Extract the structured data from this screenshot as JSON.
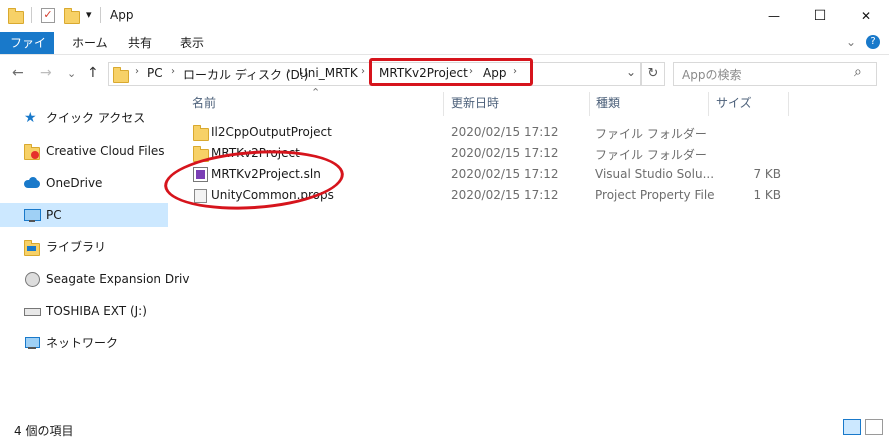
{
  "window": {
    "title": "App",
    "minimize_glyph": "—",
    "maximize_glyph": "☐",
    "close_glyph": "✕"
  },
  "ribbon": {
    "tabs": [
      {
        "label": "ファイル"
      },
      {
        "label": "ホーム"
      },
      {
        "label": "共有"
      },
      {
        "label": "表示"
      }
    ],
    "expand_glyph": "⌄",
    "help_glyph": "?"
  },
  "nav": {
    "back_glyph": "←",
    "forward_glyph": "→",
    "recent_glyph": "⌄",
    "up_glyph": "↑",
    "breadcrumbs": [
      "PC",
      "ローカル ディスク (D:)",
      "Uni_MRTK",
      "MRTKv2Project",
      "App"
    ],
    "sep_glyph": "›",
    "dropdown_glyph": "⌄",
    "refresh_glyph": "↻",
    "search_placeholder": "Appの検索",
    "search_glyph": "⌕"
  },
  "sidebar": {
    "items": [
      {
        "label": "クイック アクセス",
        "icon": "star-icon"
      },
      {
        "label": "Creative Cloud Files",
        "icon": "creative-cloud-icon"
      },
      {
        "label": "OneDrive",
        "icon": "cloud-icon"
      },
      {
        "label": "PC",
        "icon": "pc-icon",
        "selected": true
      },
      {
        "label": "ライブラリ",
        "icon": "library-icon"
      },
      {
        "label": "Seagate Expansion Driv",
        "icon": "drive-icon"
      },
      {
        "label": "TOSHIBA EXT (J:)",
        "icon": "drive-icon"
      },
      {
        "label": "ネットワーク",
        "icon": "network-icon"
      }
    ]
  },
  "columns": {
    "name": "名前",
    "modified": "更新日時",
    "type": "種類",
    "size": "サイズ",
    "sort_glyph": "⌃"
  },
  "files": [
    {
      "name": "Il2CppOutputProject",
      "modified": "2020/02/15 17:12",
      "type": "ファイル フォルダー",
      "size": "",
      "icon": "folder-icon"
    },
    {
      "name": "MRTKv2Project",
      "modified": "2020/02/15 17:12",
      "type": "ファイル フォルダー",
      "size": "",
      "icon": "folder-icon"
    },
    {
      "name": "MRTKv2Project.sln",
      "modified": "2020/02/15 17:12",
      "type": "Visual Studio Solu...",
      "size": "7 KB",
      "icon": "visual-studio-solution-icon"
    },
    {
      "name": "UnityCommon.props",
      "modified": "2020/02/15 17:12",
      "type": "Project Property File",
      "size": "1 KB",
      "icon": "props-file-icon"
    }
  ],
  "status": {
    "item_count": "4 個の項目"
  },
  "colors": {
    "accent": "#1979ca",
    "selection": "#cce8ff",
    "annotation_red": "#d6141c",
    "folder": "#f7d167"
  }
}
